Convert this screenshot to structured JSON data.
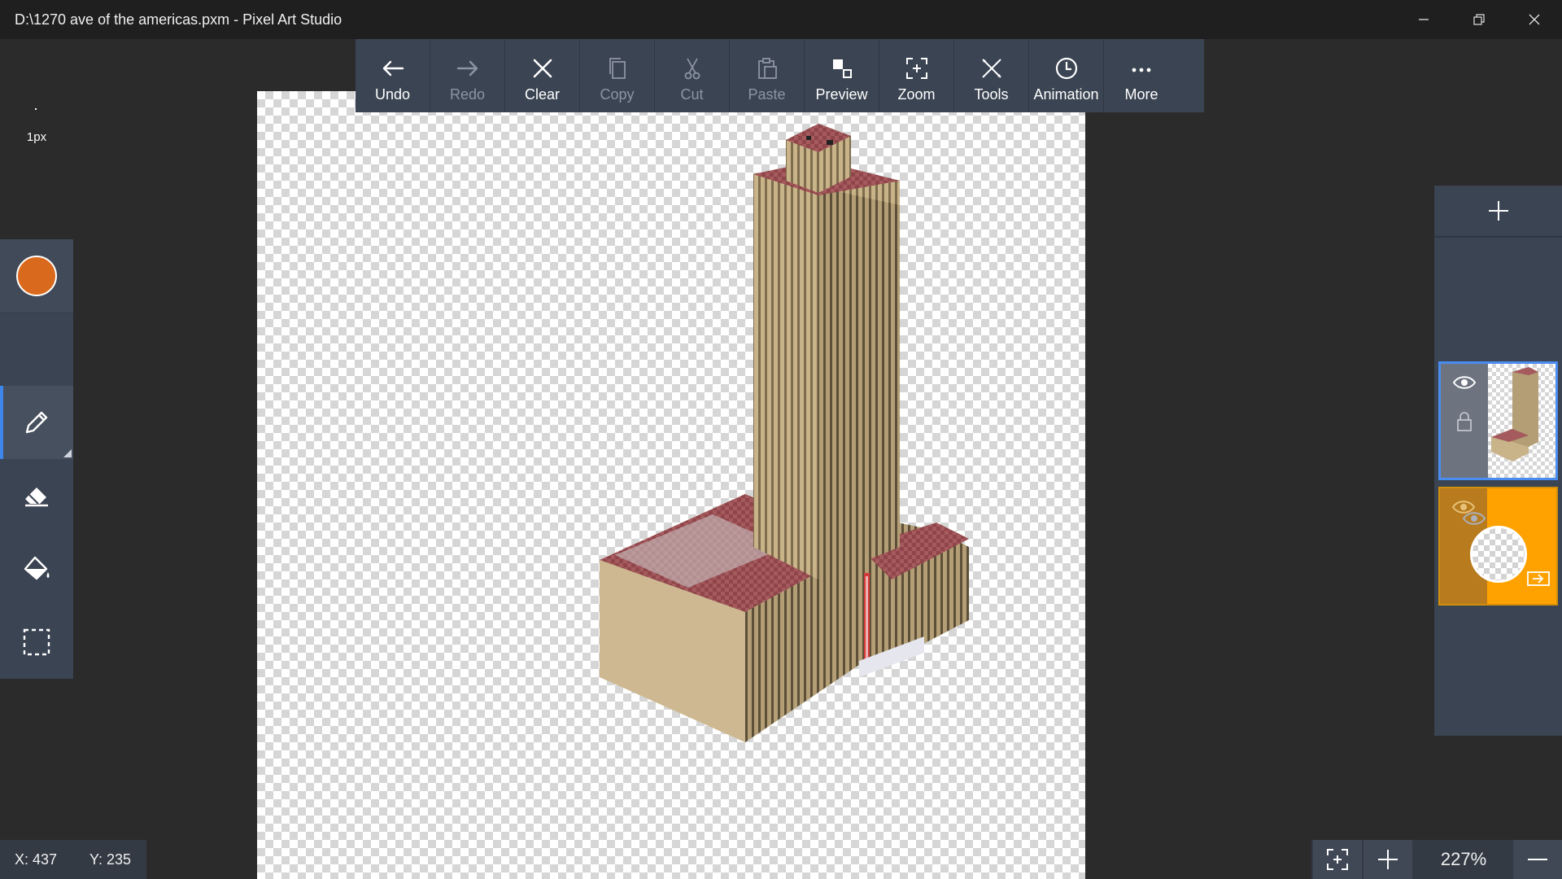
{
  "window": {
    "title": "D:\\1270 ave of the americas.pxm - Pixel Art Studio",
    "controls": [
      "minimize-icon",
      "restore-icon",
      "close-icon"
    ]
  },
  "toolbar": {
    "items": [
      {
        "label": "Undo",
        "icon": "arrow-left-icon",
        "enabled": true
      },
      {
        "label": "Redo",
        "icon": "arrow-right-icon",
        "enabled": false
      },
      {
        "label": "Clear",
        "icon": "x-icon",
        "enabled": true
      },
      {
        "label": "Copy",
        "icon": "copy-icon",
        "enabled": false
      },
      {
        "label": "Cut",
        "icon": "scissors-icon",
        "enabled": false
      },
      {
        "label": "Paste",
        "icon": "paste-icon",
        "enabled": false
      },
      {
        "label": "Preview",
        "icon": "preview-icon",
        "enabled": true
      },
      {
        "label": "Zoom",
        "icon": "zoom-frame-icon",
        "enabled": true
      },
      {
        "label": "Tools",
        "icon": "tools-icon",
        "enabled": true
      },
      {
        "label": "Animation",
        "icon": "clock-icon",
        "enabled": true
      },
      {
        "label": "More",
        "icon": "more-dots-icon",
        "enabled": true
      }
    ]
  },
  "left_panel": {
    "current_color": "#d96a1d",
    "brush_size_label": "1px",
    "tools": [
      {
        "name": "pencil",
        "icon": "pencil-icon",
        "active": true
      },
      {
        "name": "eraser",
        "icon": "eraser-icon",
        "active": false
      },
      {
        "name": "fill",
        "icon": "paint-bucket-icon",
        "active": false
      },
      {
        "name": "selection",
        "icon": "selection-icon",
        "active": false
      }
    ]
  },
  "layers": {
    "add_icon": "plus-icon",
    "items": [
      {
        "kind": "artwork",
        "visible": true,
        "locked": true,
        "selected": true,
        "accent": "#4a8cf0"
      },
      {
        "kind": "solid",
        "visible": true,
        "locked": false,
        "selected": false,
        "fill_color": "#ffa200",
        "side_color": "#b87b1e"
      }
    ],
    "background": {
      "visible": true,
      "export_icon": "export-icon"
    }
  },
  "status": {
    "x": "X: 437",
    "y": "Y: 235"
  },
  "zoom": {
    "value": "227%",
    "fit_icon": "fit-screen-icon",
    "in_icon": "zoom-in-icon",
    "out_icon": "zoom-out-icon"
  }
}
